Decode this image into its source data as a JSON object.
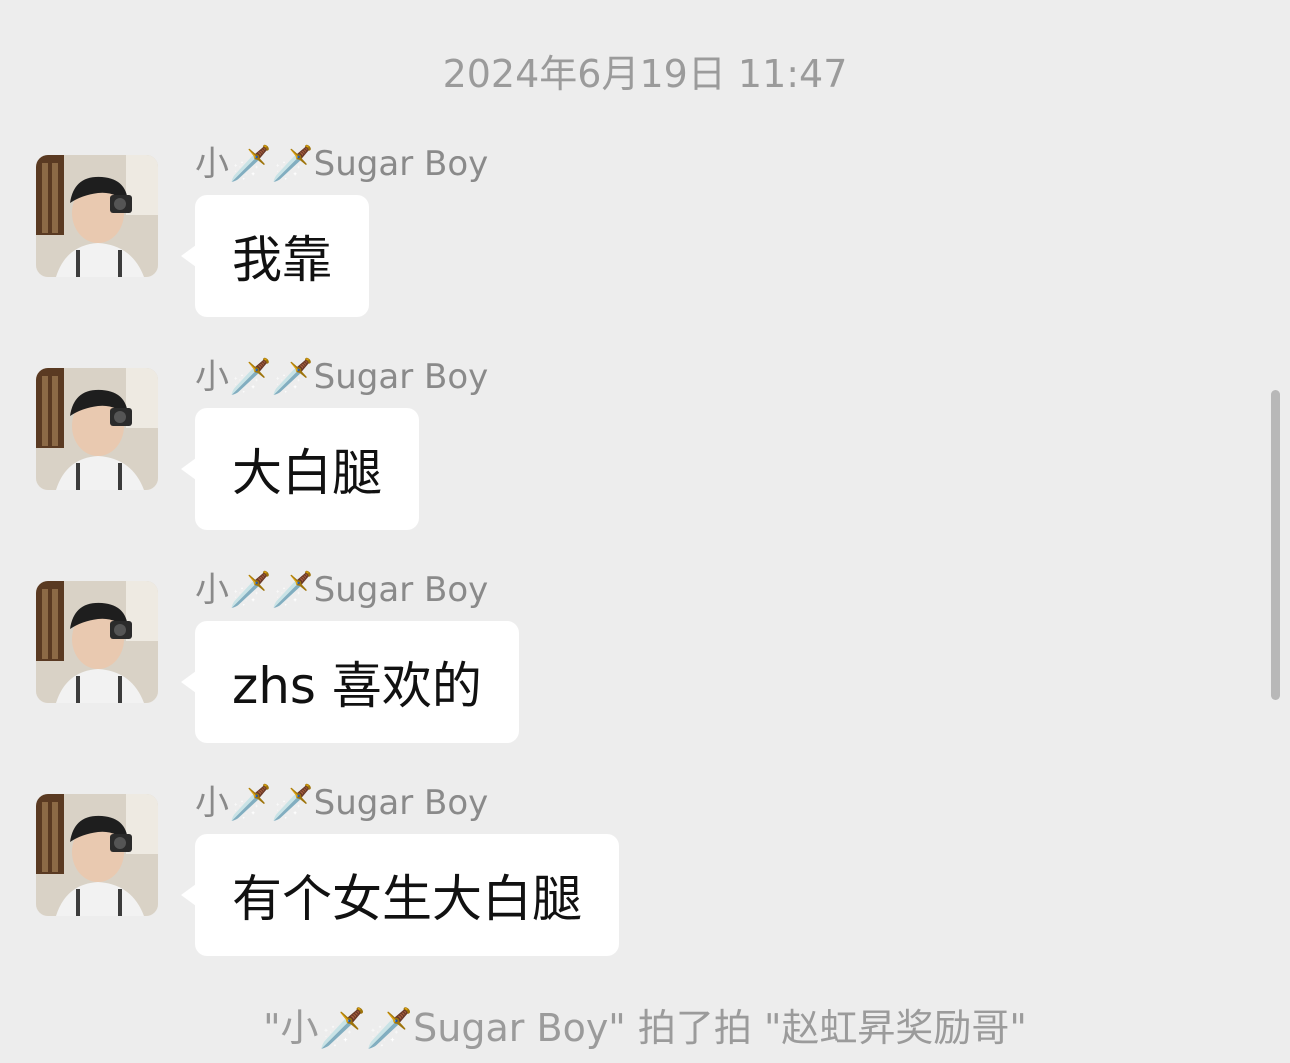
{
  "chat": {
    "timestamp": "2024年6月19日 11:47",
    "messages": [
      {
        "sender": "小🗡️🗡️Sugar Boy",
        "text": "我靠",
        "avatar_icon": "profile-photo"
      },
      {
        "sender": "小🗡️🗡️Sugar Boy",
        "text": "大白腿",
        "avatar_icon": "profile-photo"
      },
      {
        "sender": "小🗡️🗡️Sugar Boy",
        "text": "zhs 喜欢的",
        "avatar_icon": "profile-photo"
      },
      {
        "sender": "小🗡️🗡️Sugar Boy",
        "text": "有个女生大白腿",
        "avatar_icon": "profile-photo"
      }
    ],
    "system_notice": "\"小🗡️🗡️Sugar Boy\" 拍了拍 \"赵虹昇奖励哥\""
  },
  "colors": {
    "background": "#ededed",
    "bubble": "#ffffff",
    "meta_text": "#9b9b9b",
    "sender_text": "#8a8a8a",
    "message_text": "#111111"
  }
}
